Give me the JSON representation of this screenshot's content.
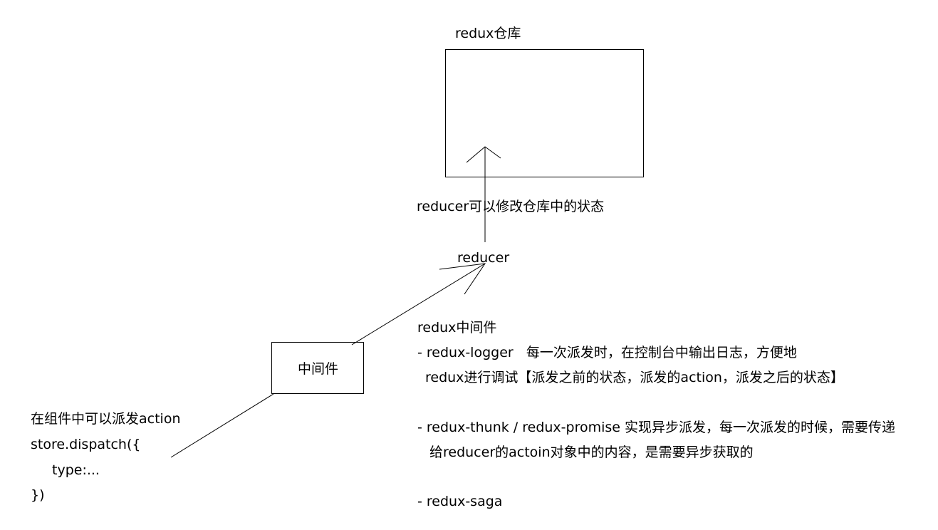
{
  "store": {
    "title": "redux仓库"
  },
  "reducer": {
    "annotation": "reducer可以修改仓库中的状态",
    "label": "reducer"
  },
  "middleware": {
    "box_label": "中间件"
  },
  "component": {
    "line1": "在组件中可以派发action",
    "line2": "store.dispatch({",
    "line3": "type:...",
    "line4": "})"
  },
  "notes": {
    "heading": "redux中间件",
    "logger_line1": "- redux-logger   每一次派发时，在控制台中输出日志，方便地",
    "logger_line2": "redux进行调试【派发之前的状态，派发的action，派发之后的状态】",
    "thunk_line1": "- redux-thunk / redux-promise 实现异步派发，每一次派发的时候，需要传递",
    "thunk_line2": "给reducer的actoin对象中的内容，是需要异步获取的",
    "saga_line": "- redux-saga"
  }
}
